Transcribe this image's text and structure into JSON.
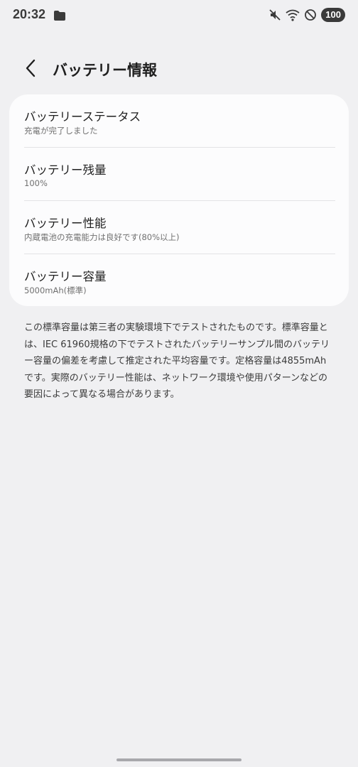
{
  "status_bar": {
    "time": "20:32",
    "battery_level": "100",
    "icons": [
      "folder-icon",
      "mute-icon",
      "wifi-icon",
      "do-not-disturb-icon"
    ]
  },
  "header": {
    "title": "バッテリー情報",
    "back_icon": "back-arrow-icon"
  },
  "battery_info": {
    "items": [
      {
        "title": "バッテリーステータス",
        "subtitle": "充電が完了しました"
      },
      {
        "title": "バッテリー残量",
        "subtitle": "100%"
      },
      {
        "title": "バッテリー性能",
        "subtitle": "内蔵電池の充電能力は良好です(80%以上)"
      },
      {
        "title": "バッテリー容量",
        "subtitle": "5000mAh(標準)"
      }
    ]
  },
  "note": {
    "text": "この標準容量は第三者の実験環境下でテストされたものです。標準容量とは、IEC 61960規格の下でテストされたバッテリーサンプル間のバッテリー容量の偏差を考慮して推定された平均容量です。定格容量は4855mAhです。実際のバッテリー性能は、ネットワーク環境や使用パターンなどの要因によって異なる場合があります。"
  },
  "colors": {
    "background": "#f0f0f2",
    "card": "#fcfcfd",
    "text_primary": "#1f1f1f",
    "text_secondary": "#707070"
  }
}
